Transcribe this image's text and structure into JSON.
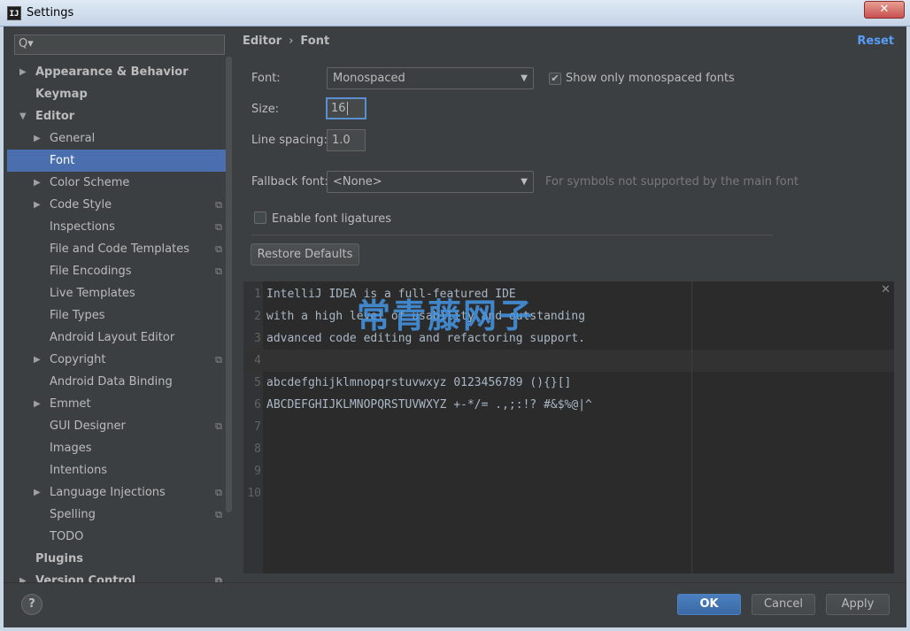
{
  "window": {
    "title": "Settings",
    "app_icon_text": "IJ",
    "close_glyph": "✕"
  },
  "search": {
    "icon": "search-icon",
    "glyph": "Q▾",
    "value": ""
  },
  "sidebar": {
    "items": [
      {
        "label": "Appearance & Behavior",
        "level": 0,
        "bold": true,
        "arrow": "▶",
        "copy": false
      },
      {
        "label": "Keymap",
        "level": 0,
        "bold": true,
        "arrow": "",
        "copy": false
      },
      {
        "label": "Editor",
        "level": 0,
        "bold": true,
        "arrow": "▼",
        "copy": false
      },
      {
        "label": "General",
        "level": 1,
        "bold": false,
        "arrow": "▶",
        "copy": false
      },
      {
        "label": "Font",
        "level": 1,
        "bold": false,
        "arrow": "",
        "copy": false,
        "selected": true
      },
      {
        "label": "Color Scheme",
        "level": 1,
        "bold": false,
        "arrow": "▶",
        "copy": false
      },
      {
        "label": "Code Style",
        "level": 1,
        "bold": false,
        "arrow": "▶",
        "copy": true
      },
      {
        "label": "Inspections",
        "level": 1,
        "bold": false,
        "arrow": "",
        "copy": true
      },
      {
        "label": "File and Code Templates",
        "level": 1,
        "bold": false,
        "arrow": "",
        "copy": true
      },
      {
        "label": "File Encodings",
        "level": 1,
        "bold": false,
        "arrow": "",
        "copy": true
      },
      {
        "label": "Live Templates",
        "level": 1,
        "bold": false,
        "arrow": "",
        "copy": false
      },
      {
        "label": "File Types",
        "level": 1,
        "bold": false,
        "arrow": "",
        "copy": false
      },
      {
        "label": "Android Layout Editor",
        "level": 1,
        "bold": false,
        "arrow": "",
        "copy": false
      },
      {
        "label": "Copyright",
        "level": 1,
        "bold": false,
        "arrow": "▶",
        "copy": true
      },
      {
        "label": "Android Data Binding",
        "level": 1,
        "bold": false,
        "arrow": "",
        "copy": false
      },
      {
        "label": "Emmet",
        "level": 1,
        "bold": false,
        "arrow": "▶",
        "copy": false
      },
      {
        "label": "GUI Designer",
        "level": 1,
        "bold": false,
        "arrow": "",
        "copy": true
      },
      {
        "label": "Images",
        "level": 1,
        "bold": false,
        "arrow": "",
        "copy": false
      },
      {
        "label": "Intentions",
        "level": 1,
        "bold": false,
        "arrow": "",
        "copy": false
      },
      {
        "label": "Language Injections",
        "level": 1,
        "bold": false,
        "arrow": "▶",
        "copy": true
      },
      {
        "label": "Spelling",
        "level": 1,
        "bold": false,
        "arrow": "",
        "copy": true
      },
      {
        "label": "TODO",
        "level": 1,
        "bold": false,
        "arrow": "",
        "copy": false
      },
      {
        "label": "Plugins",
        "level": 0,
        "bold": true,
        "arrow": "",
        "copy": false
      },
      {
        "label": "Version Control",
        "level": 0,
        "bold": true,
        "arrow": "▶",
        "copy": true
      }
    ],
    "copy_glyph": "⧉"
  },
  "header": {
    "breadcrumb_parent": "Editor",
    "breadcrumb_sep": "›",
    "breadcrumb_current": "Font",
    "reset_label": "Reset"
  },
  "font_settings": {
    "font_label": "Font:",
    "font_value": "Monospaced",
    "show_mono_label": "Show only monospaced fonts",
    "show_mono_checked": "✔",
    "size_label": "Size:",
    "size_value": "16",
    "line_spacing_label": "Line spacing:",
    "line_spacing_value": "1.0",
    "fallback_label": "Fallback font:",
    "fallback_value": "<None>",
    "fallback_hint": "For symbols not supported by the main font",
    "ligatures_label": "Enable font ligatures",
    "restore_label": "Restore Defaults",
    "combo_arrow": "▼"
  },
  "preview": {
    "lines": [
      "IntelliJ IDEA is a full-featured IDE",
      "with a high level of usability and outstanding",
      "advanced code editing and refactoring support.",
      "",
      "abcdefghijklmnopqrstuvwxyz 0123456789 (){}[]",
      "ABCDEFGHIJKLMNOPQRSTUVWXYZ +-*/= .,;:!? #&$%@|^",
      "",
      "",
      "",
      ""
    ],
    "current_line": 4,
    "close_glyph": "✕",
    "watermark": "常青藤网子"
  },
  "footer": {
    "help_label": "?",
    "ok_label": "OK",
    "cancel_label": "Cancel",
    "apply_label": "Apply"
  }
}
